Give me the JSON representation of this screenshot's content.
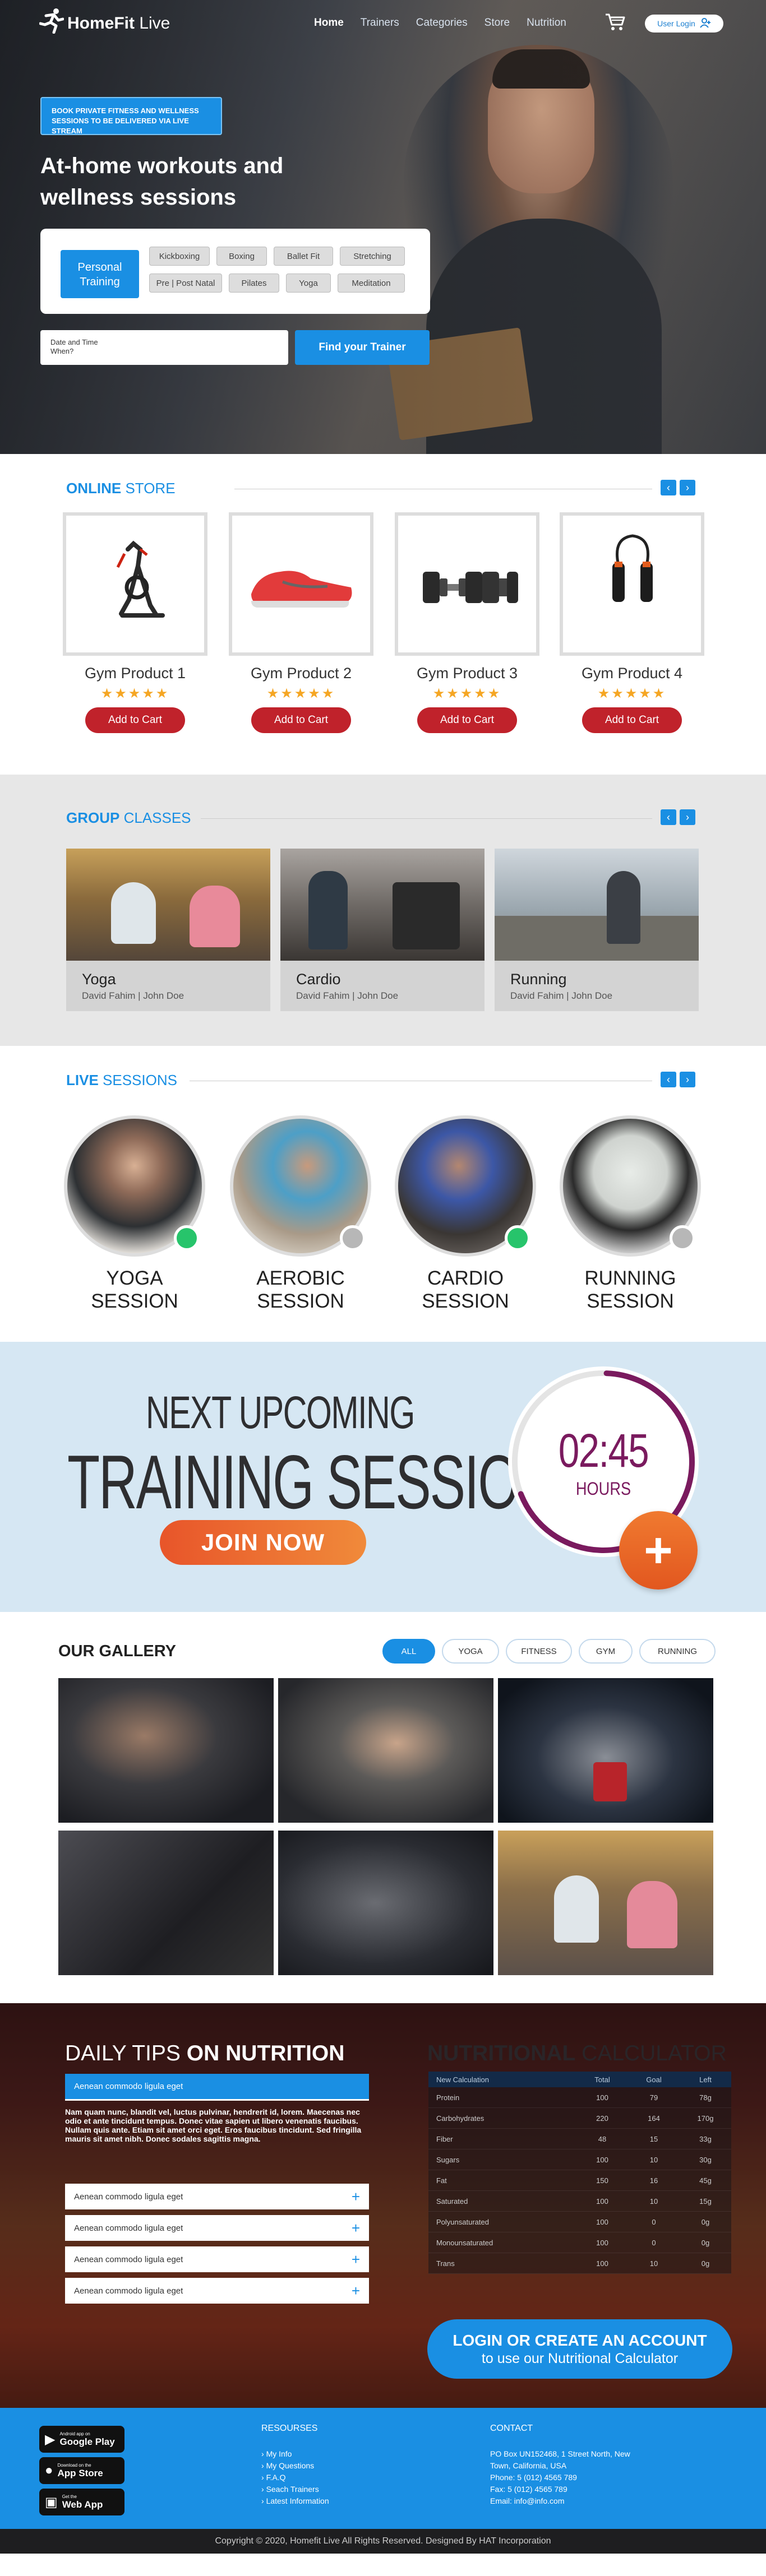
{
  "nav": {
    "logo_main": "HomeFit",
    "logo_sub": " Live",
    "items": [
      "Home",
      "Trainers",
      "Categories",
      "Store",
      "Nutrition"
    ],
    "user_login": "User Login"
  },
  "hero": {
    "promo": "BOOK PRIVATE FITNESS AND WELLNESS SESSIONS TO BE DELIVERED VIA LIVE STREAM",
    "title": "At-home workouts and wellness sessions",
    "primary_category": "Personal Training",
    "chips": [
      "Kickboxing",
      "Boxing",
      "Ballet Fit",
      "Stretching",
      "Pre | Post Natal",
      "Pilates",
      "Yoga",
      "Meditation"
    ],
    "date_label": "Date and Time",
    "date_placeholder": "When?",
    "find_button": "Find your Trainer"
  },
  "store": {
    "title_bold": "ONLINE",
    "title_rest": " STORE",
    "stars": "★★★★★",
    "add_label": "Add to Cart",
    "products": [
      {
        "name": "Gym Product 1"
      },
      {
        "name": "Gym Product 2"
      },
      {
        "name": "Gym Product 3"
      },
      {
        "name": "Gym Product 4"
      }
    ]
  },
  "group": {
    "title_bold": "GROUP",
    "title_rest": " CLASSES",
    "classes": [
      {
        "name": "Yoga",
        "trainers": "David Fahim | John Doe"
      },
      {
        "name": "Cardio",
        "trainers": "David Fahim | John Doe"
      },
      {
        "name": "Running",
        "trainers": "David Fahim | John Doe"
      }
    ]
  },
  "live": {
    "title_bold": "LIVE",
    "title_rest": " SESSIONS",
    "sessions": [
      {
        "line1": "YOGA",
        "line2": "SESSION",
        "status": "online",
        "status_color": "#27c46b"
      },
      {
        "line1": "AEROBIC",
        "line2": "SESSION",
        "status": "offline",
        "status_color": "#b7b7b7"
      },
      {
        "line1": "CARDIO",
        "line2": "SESSION",
        "status": "online",
        "status_color": "#27c46b"
      },
      {
        "line1": "RUNNING",
        "line2": "SESSION",
        "status": "offline",
        "status_color": "#b7b7b7"
      }
    ]
  },
  "next": {
    "line1": "NEXT UPCOMING",
    "line2": "TRAINING SESSION",
    "join": "JOIN NOW",
    "time": "02:45",
    "unit": "HOURS",
    "plus": "+"
  },
  "gallery": {
    "title": "OUR GALLERY",
    "filters": [
      "ALL",
      "YOGA",
      "FITNESS",
      "GYM",
      "RUNNING"
    ],
    "active_filter": "ALL"
  },
  "nutrition": {
    "title_light": "DAILY TIPS ",
    "title_bold": "ON NUTRITION",
    "open_item": "Aenean commodo ligula eget",
    "open_body": "Nam quam nunc, blandit vel, luctus pulvinar, hendrerit id, lorem. Maecenas nec odio et ante tincidunt tempus. Donec vitae sapien ut libero venenatis faucibus. Nullam quis ante. Etiam sit amet orci eget. Eros faucibus tincidunt. Sed fringilla mauris sit amet nibh. Donec sodales sagittis magna.",
    "items": [
      "Aenean commodo ligula eget",
      "Aenean commodo ligula eget",
      "Aenean commodo ligula eget",
      "Aenean commodo ligula eget"
    ],
    "calc_title_bold": "NUTRITIONAL",
    "calc_title_rest": " CALCULATOR",
    "calc_headers": [
      "New Calculation",
      "Total",
      "Goal",
      "Left"
    ],
    "calc_rows": [
      [
        "Protein",
        "100",
        "79",
        "78g"
      ],
      [
        "Carbohydrates",
        "220",
        "164",
        "170g"
      ],
      [
        "Fiber",
        "48",
        "15",
        "33g"
      ],
      [
        "Sugars",
        "100",
        "10",
        "30g"
      ],
      [
        "Fat",
        "150",
        "16",
        "45g"
      ],
      [
        "Saturated",
        "100",
        "10",
        "15g"
      ],
      [
        "Polyunsaturated",
        "100",
        "0",
        "0g"
      ],
      [
        "Monounsaturated",
        "100",
        "0",
        "0g"
      ],
      [
        "Trans",
        "100",
        "10",
        "0g"
      ]
    ],
    "cta_line1": "LOGIN OR CREATE AN ACCOUNT",
    "cta_line2": "to use our Nutritional Calculator"
  },
  "footer": {
    "badges": [
      {
        "small": "Android app on",
        "big": "Google Play"
      },
      {
        "small": "Download on the",
        "big": "App Store"
      },
      {
        "small": "Get the",
        "big": "Web App"
      }
    ],
    "resources_title": "RESOURSES",
    "resources": [
      "My Info",
      "My Questions",
      "F.A.Q",
      "Seach Trainers",
      "Latest Information"
    ],
    "contact_title": "CONTACT",
    "contact": [
      "PO Box UN152468, 1 Street North, New",
      "Town, California, USA",
      "Phone: 5 (012) 4565 789",
      "Fax: 5 (012) 4565 789",
      "Email: info@info.com"
    ],
    "copyright": "Copyright © 2020, Homefit Live All Rights Reserved. Designed By HAT Incorporation"
  }
}
